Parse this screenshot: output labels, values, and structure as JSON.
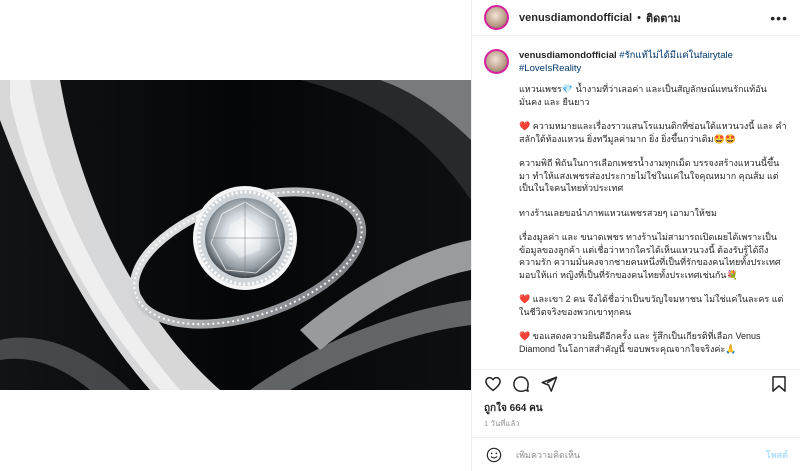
{
  "post": {
    "username": "venusdiamondofficial",
    "separator": "•",
    "follow_label": "ติดตาม",
    "more_label": "•••",
    "caption": {
      "username": "venusdiamondofficial",
      "hashtag_1": "#รักแท้ไม่ได้มีแค่ในfairytale",
      "hashtag_2": "#LoveIsReality",
      "p1_a": "แหวนเพชร",
      "p1_gem": "💎",
      "p1_b": " น้ำงามที่ว่าเลอค่า และเป็นสัญลักษณ์แทนรักแท้อันมั่นคง และ ยืนยาว",
      "p2_heart": "❤️",
      "p2": " ความหมายและเรื่องราวแสนโรแมนติกที่ซ่อนใต้แหวนวงนี้ และ คำสลักใต้ท้องแหวน ยิ่งทวีมูลค่ามาก ยิ่ง ยิ่งขึ้นกว่าเดิม🤩🤩",
      "p3": "ความพิถี พิถันในการเลือกเพชรน้ำงามทุกเม็ด บรรจงสร้างแหวนนี้ขึ้นมา ทำให้แสงเพชรส่องประกายไม่ใช่ในแค่ในใจคุณหมาก คุณส้ม แต่เป็นในใจคนไทยทั่วประเทศ",
      "p4": "ทางร้านเลยขอนำภาพแหวนเพชรสวยๆ เอามาให้ชม",
      "p5": "เรื่องมูลค่า และ ขนาดเพชร ทางร้านไม่สามารถเปิดเผยได้เพราะเป็นข้อมูลของลูกค้า แต่เชื่อว่าหากใครได้เห็นแหวนวงนี้ ต้องรับรู้ได้ถึงความรัก ความมั่นคงจากชายคนหนึ่งที่เป็นที่รักของคนไทยทั้งประเทศ มอบให้แก่ หญิงที่เป็นที่รักของคนไทยทั้งประเทศเช่นกัน💐",
      "p6_heart": "❤️",
      "p6": " และเขา 2 คน จึงได้ชื่อว่าเป็นขวัญใจมหาชน ไม่ใช่แค่ในละคร แต่ในชีวิตจริงของพวกเขาทุกคน",
      "p7_heart": "❤️",
      "p7": " ขอแสดงความยินดีอีกครั้ง และ รู้สึกเป็นเกียรติที่เลือก Venus Diamond ในโอกาสสำคัญนี้ ขอบพระคุณจากใจจริงค่ะ🙏"
    },
    "likes_text": "ถูกใจ 664 คน",
    "time_text": "1 วันที่แล้ว",
    "comment_placeholder": "เพิ่มความคิดเห็น",
    "post_button": "โพสต์"
  },
  "icons": {
    "like": "heart-icon",
    "comment": "comment-icon",
    "share": "share-icon",
    "save": "bookmark-icon",
    "emoji": "emoji-icon"
  }
}
